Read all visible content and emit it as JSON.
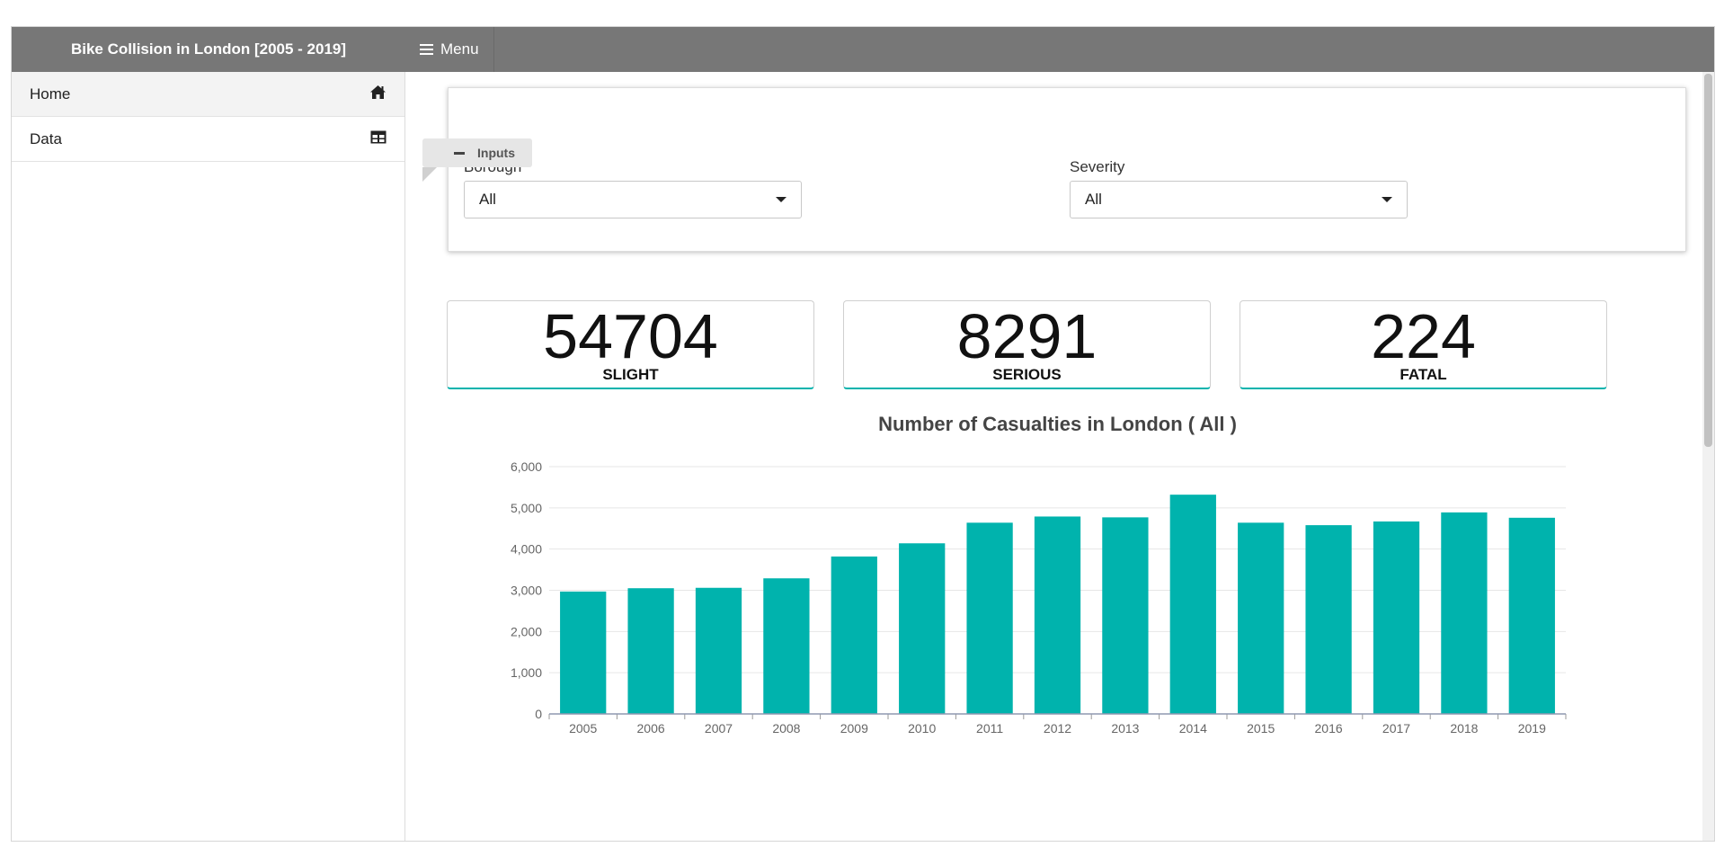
{
  "header": {
    "title": "Bike Collision in London [2005 - 2019]",
    "menu_label": "Menu"
  },
  "sidebar": {
    "items": [
      {
        "label": "Home",
        "icon": "home-icon"
      },
      {
        "label": "Data",
        "icon": "table-icon"
      }
    ]
  },
  "inputs": {
    "tab_label": "Inputs",
    "borough": {
      "label": "Borough",
      "value": "All"
    },
    "severity": {
      "label": "Severity",
      "value": "All"
    }
  },
  "kpis": [
    {
      "value": "54704",
      "label": "SLIGHT"
    },
    {
      "value": "8291",
      "label": "SERIOUS"
    },
    {
      "value": "224",
      "label": "FATAL"
    }
  ],
  "colors": {
    "accent": "#00b3ad",
    "topbar": "#777777"
  },
  "chart_data": {
    "type": "bar",
    "title": "Number of Casualties in London ( All )",
    "xlabel": "",
    "ylabel": "",
    "categories": [
      "2005",
      "2006",
      "2007",
      "2008",
      "2009",
      "2010",
      "2011",
      "2012",
      "2013",
      "2014",
      "2015",
      "2016",
      "2017",
      "2018",
      "2019"
    ],
    "values": [
      2970,
      3050,
      3060,
      3290,
      3820,
      4140,
      4640,
      4790,
      4770,
      5320,
      4640,
      4580,
      4670,
      4890,
      4760
    ],
    "ylim": [
      0,
      6000
    ],
    "yticks": [
      0,
      1000,
      2000,
      3000,
      4000,
      5000,
      6000
    ],
    "ytick_labels": [
      "0",
      "1,000",
      "2,000",
      "3,000",
      "4,000",
      "5,000",
      "6,000"
    ],
    "color": "#00b3ad",
    "grid": true,
    "legend": "none"
  }
}
